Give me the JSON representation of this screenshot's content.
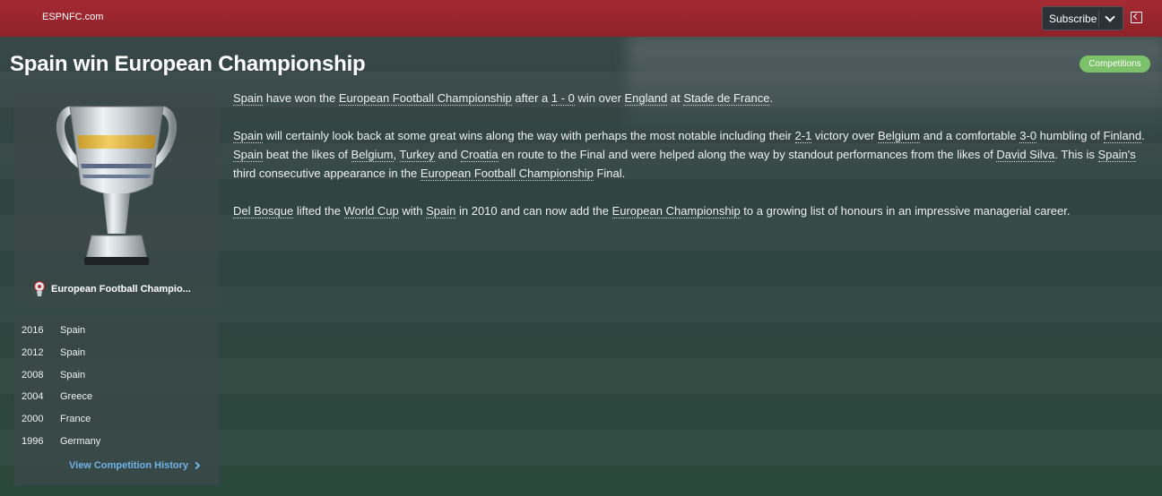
{
  "header": {
    "source": "ESPNFC.com",
    "subscribe_label": "Subscribe",
    "collapse_icon": "collapse-panel-icon"
  },
  "article": {
    "title": "Spain win European Championship",
    "category": "Competitions",
    "p1": {
      "a": "Spain",
      "b": " have won the ",
      "c": "European Football Championship",
      "d": " after a ",
      "e": "1 - 0",
      "f": " win over ",
      "g": "England",
      "h": " at ",
      "i": "Stade de France",
      "j": "."
    },
    "p2": {
      "a": "Spain",
      "b": " will certainly look back at some great wins along the way with perhaps the most notable including their ",
      "c": "2-1",
      "d": " victory over ",
      "e": "Belgium",
      "f": " and a comfortable ",
      "g": "3-0",
      "h": " humbling of ",
      "i": "Finland",
      "j": ". ",
      "k": "Spain",
      "l": " beat the likes of ",
      "m": "Belgium",
      "n": ", ",
      "o": "Turkey",
      "p": " and ",
      "q": "Croatia",
      "r": " en route to the Final and were helped along the way by standout performances from the likes of ",
      "s": "David Silva",
      "t": ". This is ",
      "u": "Spain's",
      "v": " third consecutive appearance in the ",
      "w": "European Football Championship",
      "x": " Final."
    },
    "p3": {
      "a": "Del Bosque",
      "b": " lifted the ",
      "c": "World Cup",
      "d": " with ",
      "e": "Spain",
      "f": " in 2010 and can now add the ",
      "g": "European Championship",
      "h": " to a growing list of honours in an impressive managerial career."
    }
  },
  "competition": {
    "name": "European Football Champio...",
    "trophy_icon": "trophy-icon",
    "logo_icon": "competition-logo-icon"
  },
  "history": {
    "rows": [
      {
        "year": "2016",
        "team": "Spain"
      },
      {
        "year": "2012",
        "team": "Spain"
      },
      {
        "year": "2008",
        "team": "Spain"
      },
      {
        "year": "2004",
        "team": "Greece"
      },
      {
        "year": "2000",
        "team": "France"
      },
      {
        "year": "1996",
        "team": "Germany"
      }
    ],
    "view_label": "View Competition History"
  },
  "colors": {
    "topbar": "#a52a33",
    "badge": "#7cc26a",
    "link": "#6fb4e8"
  }
}
